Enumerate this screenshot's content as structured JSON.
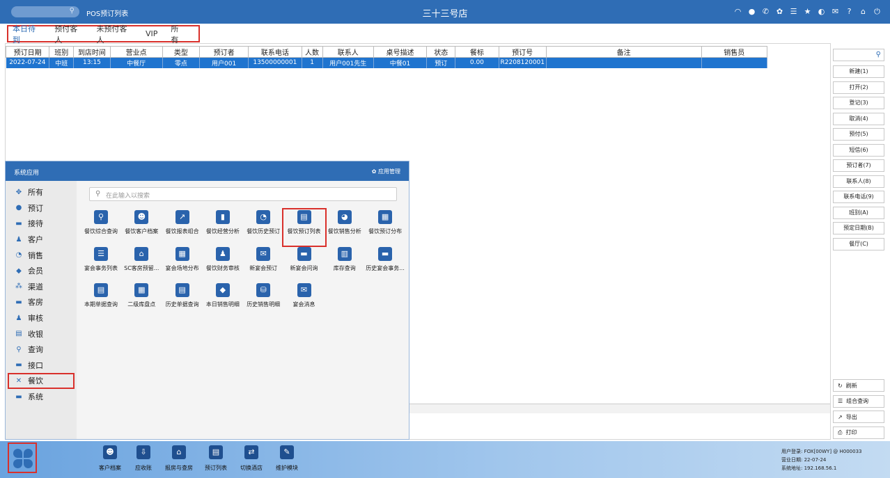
{
  "topbar": {
    "window_title": "POS预订列表",
    "store_name": "三十三号店",
    "icons": [
      "wifi-icon",
      "chat-icon",
      "phone-icon",
      "palette-icon",
      "menu-icon",
      "star-icon",
      "theme-icon",
      "mail-icon",
      "help-icon",
      "home-icon",
      "power-icon"
    ]
  },
  "tabs": [
    "本日待到",
    "预付客人",
    "未预付客人",
    "VIP",
    "所有"
  ],
  "grid": {
    "headers": [
      "预订日期",
      "班别",
      "到店时间",
      "营业点",
      "类型",
      "预订者",
      "联系电话",
      "人数",
      "联系人",
      "桌号描述",
      "状态",
      "餐标",
      "预订号",
      "备注",
      "销售员"
    ],
    "rows": [
      [
        "2022-07-24",
        "中班",
        "13:15",
        "中餐厅",
        "零点",
        "用户001",
        "13500000001",
        "1",
        "用户001先生",
        "中餐01",
        "预订",
        "0.00",
        "R2208120001",
        "",
        ""
      ]
    ]
  },
  "right_buttons": [
    "新建(1)",
    "打开(2)",
    "登记(3)",
    "取消(4)",
    "预付(5)",
    "短信(6)",
    "预订者(7)",
    "联系人(8)",
    "联系电话(9)",
    "班别(A)",
    "预定日期(B)",
    "餐厅(C)"
  ],
  "right_bottom_buttons": [
    {
      "icon": "refresh-icon",
      "label": "刷新"
    },
    {
      "icon": "list-icon",
      "label": "组合查询"
    },
    {
      "icon": "export-icon",
      "label": "导出"
    },
    {
      "icon": "print-icon",
      "label": "打印"
    }
  ],
  "app_panel": {
    "title": "系统应用",
    "manage_label": "应用管理",
    "search_placeholder": "在此输入以搜索",
    "categories": [
      "所有",
      "预订",
      "接待",
      "客户",
      "销售",
      "会员",
      "渠道",
      "客房",
      "审核",
      "收银",
      "查询",
      "接口",
      "餐饮",
      "系统"
    ],
    "selected_category": "餐饮",
    "apps": [
      "餐饮综合查询",
      "餐饮客户档案",
      "餐饮报表组合",
      "餐饮经营分析",
      "餐饮历史预订",
      "餐饮预订列表",
      "餐饮销售分析",
      "餐饮预订分布",
      "宴会事务列表",
      "SC客房预留...",
      "宴会场地分布",
      "餐饮财务审核",
      "新宴会预订",
      "新宴会问询",
      "库存查询",
      "历史宴会事务...",
      "本期单据查询",
      "二级库盘点",
      "历史单据查询",
      "本日销售明细",
      "历史销售明细",
      "宴会消息"
    ],
    "selected_app": "餐饮预订列表"
  },
  "dock": [
    "客户档案",
    "应收账",
    "报房与查房",
    "预订列表",
    "切换酒店",
    "维护模块"
  ],
  "system_info": {
    "login_label": "用户登录:",
    "login_value": "FOX[00WY] @ H000033",
    "date_label": "营业日期:",
    "date_value": "22-07-24",
    "ip_label": "系统地址:",
    "ip_value": "192.168.56.1"
  },
  "colors": {
    "primary": "#2f6db5",
    "highlight": "#d9302b",
    "selected_row": "#1f74cf"
  }
}
